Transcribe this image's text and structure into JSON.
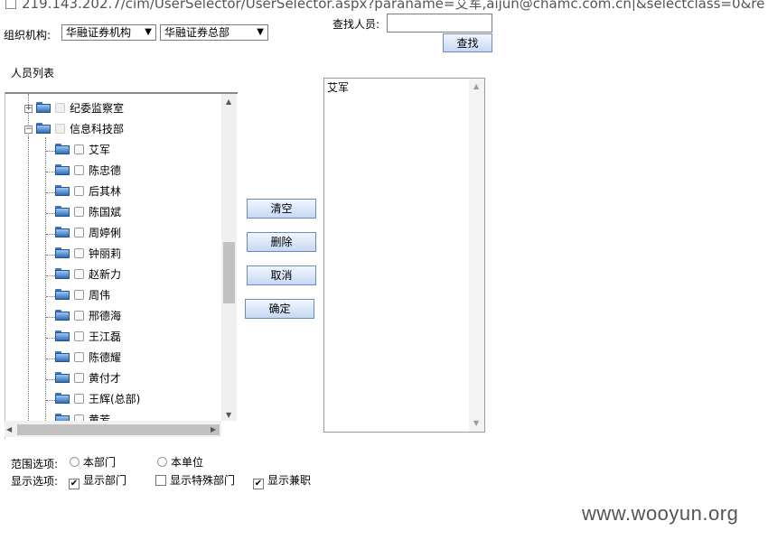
{
  "address_bar": {
    "url": "219.143.202.7/cim/UserSelector/UserSelector.aspx?paraname=艾军,aijun@chamc.com.cn|&selectclass=0&re"
  },
  "org": {
    "label": "组织机构:",
    "select1": "华融证券机构",
    "select2": "华融证券总部"
  },
  "search": {
    "label": "查找人员:",
    "value": "",
    "button": "查找"
  },
  "list_title": "人员列表",
  "tree": {
    "departments": [
      "纪委监察室",
      "信息科技部"
    ],
    "people": [
      "艾军",
      "陈忠德",
      "后其林",
      "陈国斌",
      "周婷俐",
      "钟丽莉",
      "赵新力",
      "周伟",
      "邢德海",
      "王江磊",
      "陈德耀",
      "黄付才",
      "王辉(总部)",
      "黄芳"
    ]
  },
  "actions": {
    "clear": "清空",
    "delete": "删除",
    "cancel": "取消",
    "confirm": "确定"
  },
  "selected": [
    "艾军"
  ],
  "scope": {
    "label": "范围选项:",
    "option1": "本部门",
    "option2": "本单位"
  },
  "display": {
    "label": "显示选项:",
    "option1": "显示部门",
    "option1_checked": true,
    "option2": "显示特殊部门",
    "option2_checked": false,
    "option3": "显示兼职",
    "option3_checked": true
  },
  "watermark": "www.wooyun.org"
}
